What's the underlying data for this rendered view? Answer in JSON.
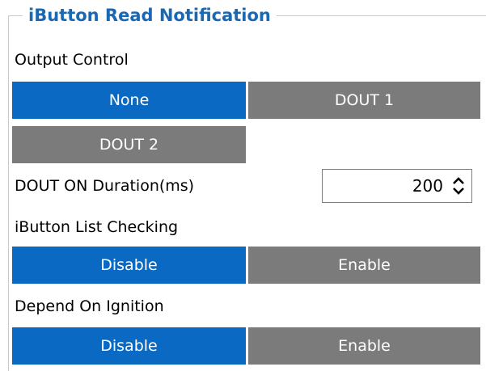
{
  "group": {
    "title": "iButton Read Notification"
  },
  "output_control": {
    "label": "Output Control",
    "options": [
      "None",
      "DOUT 1",
      "DOUT 2"
    ],
    "selected": "None"
  },
  "dout_on_duration": {
    "label": "DOUT ON Duration(ms)",
    "value": "200"
  },
  "ibutton_list_checking": {
    "label": "iButton List Checking",
    "options": [
      "Disable",
      "Enable"
    ],
    "selected": "Disable"
  },
  "depend_on_ignition": {
    "label": "Depend On Ignition",
    "options": [
      "Disable",
      "Enable"
    ],
    "selected": "Disable"
  },
  "colors": {
    "selected": "#0a6ac3",
    "unselected": "#7b7b7b",
    "title": "#1a68b3"
  },
  "icons": {
    "spinner": "up-down-chevron-icon"
  }
}
